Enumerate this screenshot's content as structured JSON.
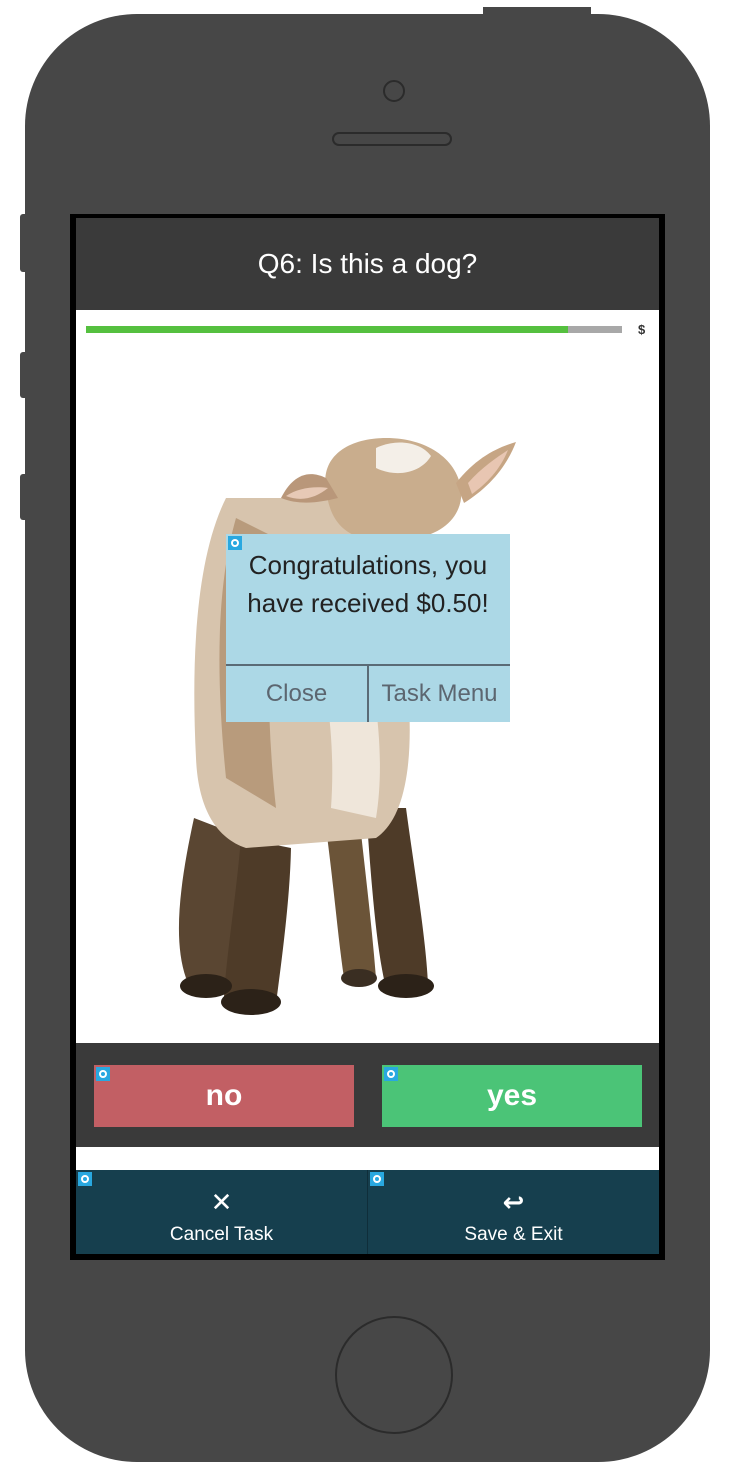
{
  "header": {
    "title": "Q6: Is this a dog?"
  },
  "progress": {
    "fraction": 0.9,
    "tail_text": "$"
  },
  "image": {
    "subject": "baby goat photo",
    "icon": "goat-image"
  },
  "popup": {
    "message": "Congratulations, you have received $0.50!",
    "close_label": "Close",
    "task_menu_label": "Task Menu"
  },
  "answers": {
    "no_label": "no",
    "yes_label": "yes",
    "colors": {
      "no": "#c25f64",
      "yes": "#4bc477"
    }
  },
  "footer": {
    "cancel": {
      "icon": "close-icon",
      "glyph": "✕",
      "label": "Cancel Task"
    },
    "save": {
      "icon": "reply-icon",
      "glyph": "↩",
      "label": "Save & Exit"
    }
  },
  "colors": {
    "header_bg": "#3a3a3a",
    "footer_bg": "#163f4e",
    "popup_bg": "#acd8e6",
    "progress_fill": "#55c03f",
    "progress_track": "#a8a8a8",
    "marker": "#29a8e0",
    "device_body": "#474747"
  }
}
